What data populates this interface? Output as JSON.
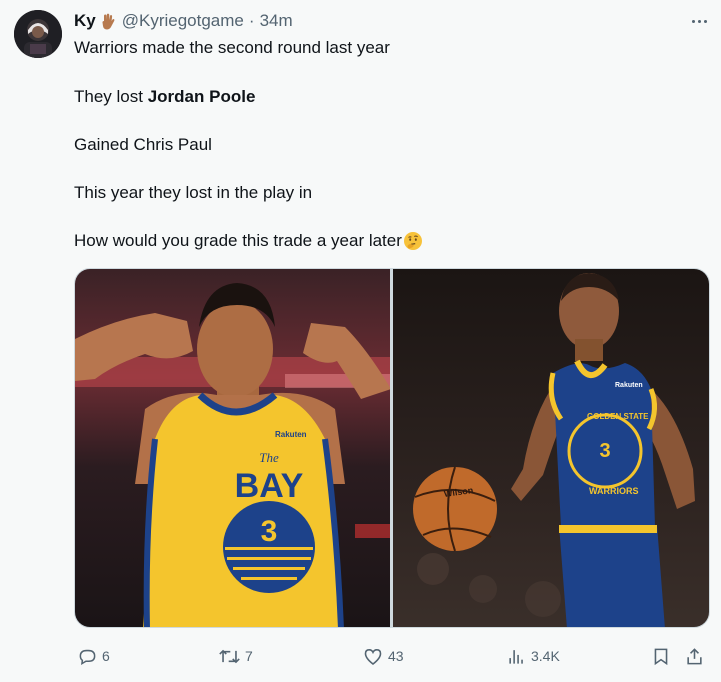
{
  "tweet": {
    "author": {
      "display_name": "Ky",
      "handle": "@Kyriegotgame",
      "separator": "·",
      "time": "34m"
    },
    "lines": [
      "Warriors made the second round last year",
      "They lost",
      "Jordan Poole",
      "Gained Chris Paul",
      "This year they lost in the play in",
      "How would you grade this trade a year later"
    ],
    "media": {
      "left_photo": {
        "jersey_top": "The",
        "jersey_word": "BAY",
        "jersey_number": "3",
        "patch": "Rakuten"
      },
      "right_photo": {
        "jersey_arc_1": "GOLDEN STATE",
        "jersey_arc_2": "WARRIORS",
        "jersey_number": "3",
        "ball_brand": "Wilson",
        "patch": "Rakuten"
      }
    },
    "actions": {
      "replies": "6",
      "retweets": "7",
      "likes": "43",
      "views": "3.4K"
    }
  },
  "colors": {
    "background": "#f7f9f9",
    "text": "#0f1419",
    "secondary_text": "#536471",
    "warriors_gold": "#f4c52d",
    "warriors_blue": "#1d428a"
  },
  "icons": {
    "author_badge": "raised-hand-emoji",
    "trailing_emoji": "thinking-face-emoji",
    "reply": "reply-icon",
    "retweet": "retweet-icon",
    "like": "heart-icon",
    "views": "views-icon",
    "bookmark": "bookmark-icon",
    "share": "share-icon",
    "more": "more-icon"
  }
}
